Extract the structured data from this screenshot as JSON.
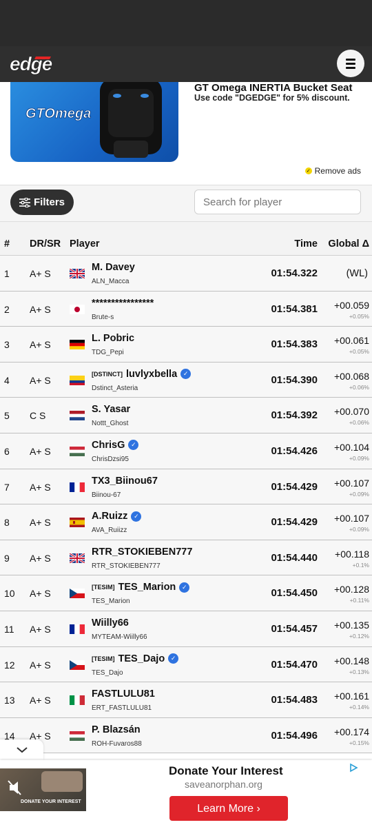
{
  "brand": {
    "logo_text": "edge"
  },
  "ad": {
    "image_brand": "GTOmega",
    "title": "GT Omega INERTIA Bucket Seat",
    "subtitle": "Use code \"DGEDGE\" for 5% discount.",
    "remove_ads": "Remove ads"
  },
  "controls": {
    "filters_label": "Filters",
    "search_placeholder": "Search for player"
  },
  "table": {
    "headers": {
      "pos": "#",
      "dr": "DR/SR",
      "player": "Player",
      "time": "Time",
      "gap": "Global Δ"
    },
    "rows": [
      {
        "pos": "1",
        "dr": "A+ S",
        "flag": "gb",
        "tag": "",
        "name": "M. Davey",
        "verified": false,
        "user": "ALN_Macca",
        "time": "01:54.322",
        "gap": "(WL)",
        "pct": ""
      },
      {
        "pos": "2",
        "dr": "A+ S",
        "flag": "jp",
        "tag": "",
        "name": "****************",
        "verified": false,
        "user": "Brute-s",
        "time": "01:54.381",
        "gap": "+00.059",
        "pct": "+0.05%"
      },
      {
        "pos": "3",
        "dr": "A+ S",
        "flag": "de",
        "tag": "",
        "name": "L. Pobric",
        "verified": false,
        "user": "TDG_Pepi",
        "time": "01:54.383",
        "gap": "+00.061",
        "pct": "+0.05%"
      },
      {
        "pos": "4",
        "dr": "A+ S",
        "flag": "co",
        "tag": "[DSTINCT]",
        "name": "luvlyxbella",
        "verified": true,
        "user": "Dstinct_Asteria",
        "time": "01:54.390",
        "gap": "+00.068",
        "pct": "+0.06%"
      },
      {
        "pos": "5",
        "dr": "C S",
        "flag": "nl",
        "tag": "",
        "name": "S. Yasar",
        "verified": false,
        "user": "Nottt_Ghost",
        "time": "01:54.392",
        "gap": "+00.070",
        "pct": "+0.06%"
      },
      {
        "pos": "6",
        "dr": "A+ S",
        "flag": "hu",
        "tag": "",
        "name": "ChrisG",
        "verified": true,
        "user": "ChrisDzsi95",
        "time": "01:54.426",
        "gap": "+00.104",
        "pct": "+0.09%"
      },
      {
        "pos": "7",
        "dr": "A+ S",
        "flag": "fr",
        "tag": "",
        "name": "TX3_Biinou67",
        "verified": false,
        "user": "Biinou-67",
        "time": "01:54.429",
        "gap": "+00.107",
        "pct": "+0.09%"
      },
      {
        "pos": "8",
        "dr": "A+ S",
        "flag": "es",
        "tag": "",
        "name": "A.Ruizz",
        "verified": true,
        "user": "AVA_Ruiizz",
        "time": "01:54.429",
        "gap": "+00.107",
        "pct": "+0.09%"
      },
      {
        "pos": "9",
        "dr": "A+ S",
        "flag": "gb",
        "tag": "",
        "name": "RTR_STOKIEBEN777",
        "verified": false,
        "user": "RTR_STOKIEBEN777",
        "time": "01:54.440",
        "gap": "+00.118",
        "pct": "+0.1%"
      },
      {
        "pos": "10",
        "dr": "A+ S",
        "flag": "cz",
        "tag": "[TESIM]",
        "name": "TES_Marion",
        "verified": true,
        "user": "TES_Marion",
        "time": "01:54.450",
        "gap": "+00.128",
        "pct": "+0.11%"
      },
      {
        "pos": "11",
        "dr": "A+ S",
        "flag": "fr",
        "tag": "",
        "name": "Wiilly66",
        "verified": false,
        "user": "MYTEAM-Wiilly66",
        "time": "01:54.457",
        "gap": "+00.135",
        "pct": "+0.12%"
      },
      {
        "pos": "12",
        "dr": "A+ S",
        "flag": "cz",
        "tag": "[TESIM]",
        "name": "TES_Dajo",
        "verified": true,
        "user": "TES_Dajo",
        "time": "01:54.470",
        "gap": "+00.148",
        "pct": "+0.13%"
      },
      {
        "pos": "13",
        "dr": "A+ S",
        "flag": "it",
        "tag": "",
        "name": "FASTLULU81",
        "verified": false,
        "user": "ERT_FASTLULU81",
        "time": "01:54.483",
        "gap": "+00.161",
        "pct": "+0.14%"
      },
      {
        "pos": "14",
        "dr": "A+ S",
        "flag": "hu",
        "tag": "",
        "name": "P. Blazsán",
        "verified": false,
        "user": "ROH-Fuvaros88",
        "time": "01:54.496",
        "gap": "+00.174",
        "pct": "+0.15%"
      }
    ]
  },
  "bottom_ad": {
    "image_text": "DONATE YOUR INTEREST",
    "title": "Donate Your Interest",
    "url": "saveanorphan.org",
    "button": "Learn More ›"
  },
  "colors": {
    "dark_bar": "#2f2f2f",
    "verified_blue": "#2f73e0",
    "ad_red": "#e0242b",
    "ad_blue": "#1763c4"
  }
}
